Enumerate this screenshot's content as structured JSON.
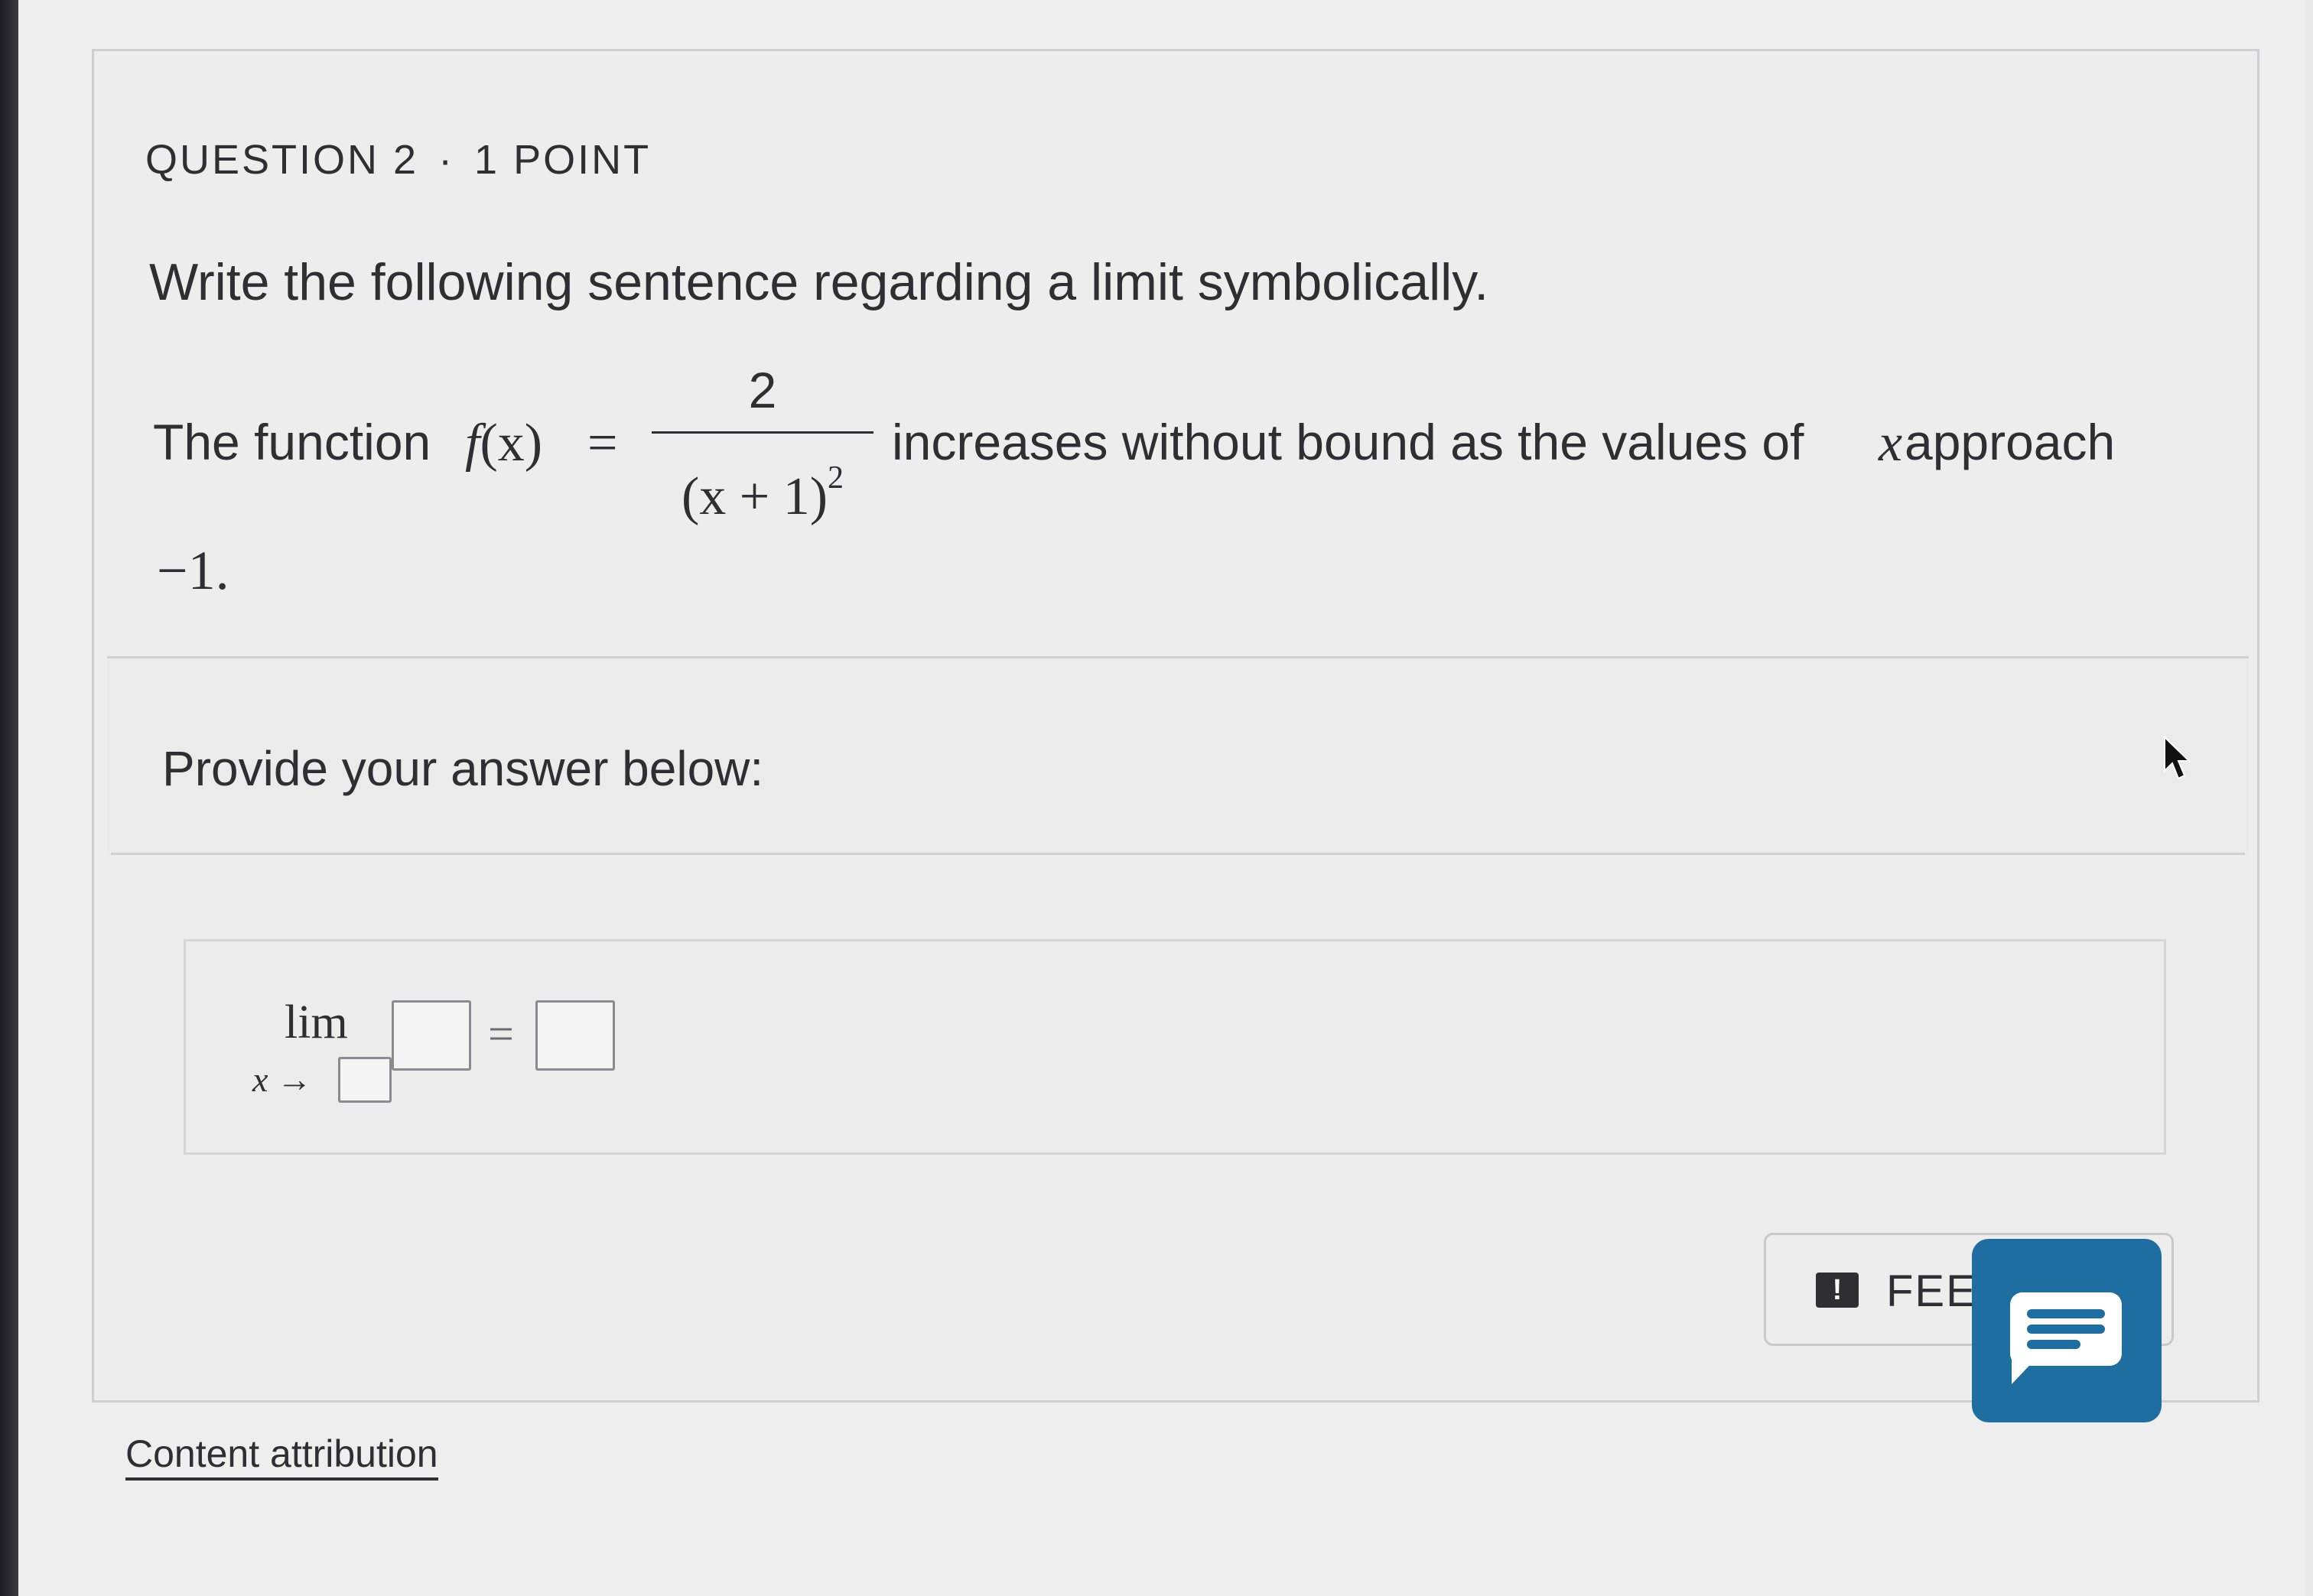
{
  "question": {
    "number_label": "QUESTION 2",
    "separator": "·",
    "points_label": "1 POINT"
  },
  "prompt": {
    "instruction": "Write the following sentence regarding a limit symbolically.",
    "sentence": {
      "prefix": "The function ",
      "function_name": "f",
      "function_arg": "(x)",
      "equals": "=",
      "numerator": "2",
      "denominator": "(x + 1)",
      "denominator_exponent": "2",
      "middle": "increases without bound as the values of ",
      "variable": "x",
      "suffix": " approach",
      "continuation": "−1."
    }
  },
  "answer_section": {
    "label": "Provide your answer below:",
    "lim_word": "lim",
    "lim_subscript": "x →",
    "equals": "=",
    "blanks": {
      "approach_value": "",
      "function_expression": "",
      "limit_result": ""
    }
  },
  "feedback": {
    "icon": "exclamation-icon",
    "label": "FEEI"
  },
  "chat": {
    "icon": "chat-bubble-icon",
    "color": "#1e6ea2"
  },
  "footer": {
    "attribution_link": "Content attribution"
  }
}
